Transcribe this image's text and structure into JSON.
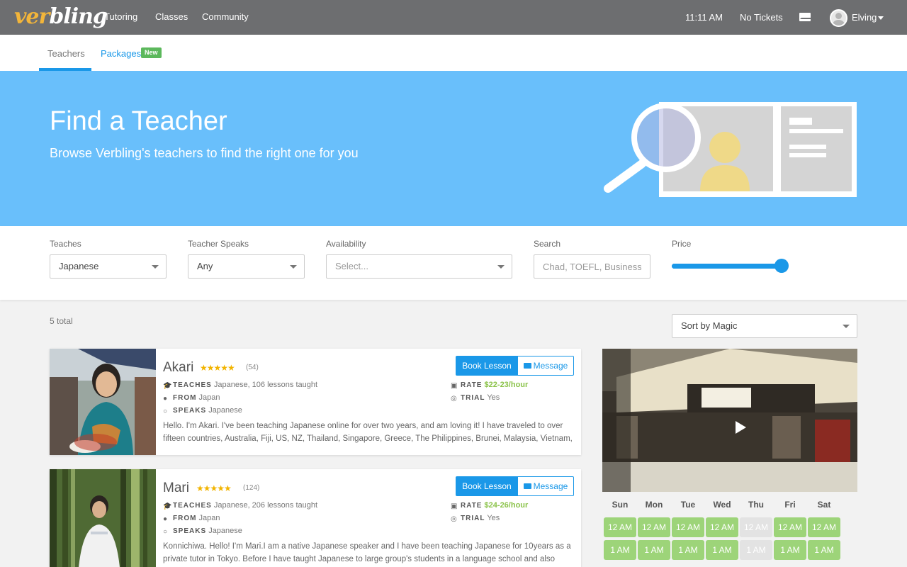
{
  "brand": {
    "logo_main": "ver",
    "logo_accent": "bling"
  },
  "topnav": {
    "links": [
      "Tutoring",
      "Classes",
      "Community"
    ],
    "time": "11:11 AM",
    "tickets": "No Tickets",
    "user": "Elving"
  },
  "subnav": {
    "teachers": "Teachers",
    "packages": "Packages",
    "new_badge": "New"
  },
  "hero": {
    "title": "Find a Teacher",
    "subtitle": "Browse Verbling's teachers to find the right one for you"
  },
  "filters": {
    "teaches_label": "Teaches",
    "teaches_value": "Japanese",
    "speaks_label": "Teacher Speaks",
    "speaks_value": "Any",
    "availability_label": "Availability",
    "availability_placeholder": "Select...",
    "search_label": "Search",
    "search_placeholder": "Chad, TOEFL, Business",
    "price_label": "Price",
    "price_level": 1.0
  },
  "results": {
    "total": "5 total",
    "sort": "Sort by Magic"
  },
  "labels": {
    "teaches": "TEACHES",
    "from": "FROM",
    "speaks": "SPEAKS",
    "rate": "RATE",
    "trial": "TRIAL",
    "book": "Book Lesson",
    "message": "Message"
  },
  "teachers": [
    {
      "name": "Akari",
      "stars": "★★★★★",
      "reviews": "(54)",
      "teaches": "Japanese, 106 lessons taught",
      "from": "Japan",
      "speaks": "Japanese",
      "rate": "$22-23/hour",
      "trial": "Yes",
      "description": "Hello. I'm Akari. I've been teaching Japanese online for over two years, and am loving it! I have traveled to over fifteen countries, Australia, Fiji, US, NZ, Thailand, Singapore, Greece, The Philippines, Brunei, Malaysia, Vietnam,"
    },
    {
      "name": "Mari",
      "stars": "★★★★★",
      "reviews": "(124)",
      "teaches": "Japanese, 206 lessons taught",
      "from": "Japan",
      "speaks": "Japanese",
      "rate": "$24-26/hour",
      "trial": "Yes",
      "description": "Konnichiwa. Hello! I'm Mari.I am a native Japanese speaker and I have been teaching Japanese for 10years as a private tutor in Tokyo. Before I have taught Japanese to large group's students in a language school and also"
    }
  ],
  "schedule": {
    "days": [
      "Sun",
      "Mon",
      "Tue",
      "Wed",
      "Thu",
      "Fri",
      "Sat"
    ],
    "rows": [
      [
        "12 AM",
        "12 AM",
        "12 AM",
        "12 AM",
        "12 AM",
        "12 AM",
        "12 AM"
      ],
      [
        "1 AM",
        "1 AM",
        "1 AM",
        "1 AM",
        "1 AM",
        "1 AM",
        "1 AM"
      ]
    ],
    "unavailable_day": "Thu"
  },
  "colors": {
    "primary": "#1a98e8",
    "hero": "#69bffb",
    "slot": "#9dd479",
    "rate": "#8bc34a",
    "star": "#f2b400"
  }
}
